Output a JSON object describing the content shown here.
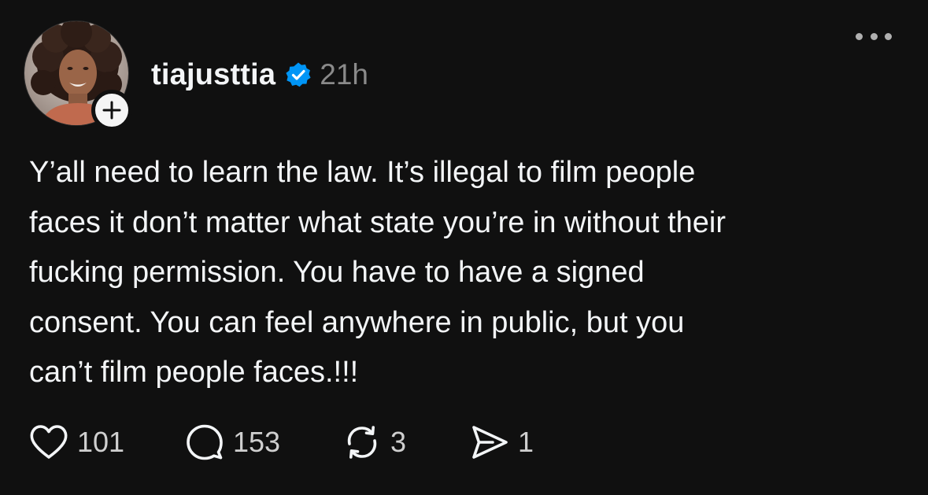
{
  "post": {
    "author": {
      "username": "tiajusttia",
      "verified": true,
      "avatar_icon": "profile-photo",
      "follow_icon": "plus-icon"
    },
    "timestamp": "21h",
    "menu_icon": "more-horizontal-icon",
    "text_lines": [
      "Y’all need to learn the law. It’s illegal to film people",
      "faces it don’t matter what state you’re in without their",
      "fucking permission. You have to have a signed",
      "consent. You can feel anywhere in public, but you",
      "can’t film people faces.!!!"
    ],
    "actions": {
      "like": {
        "icon": "heart-icon",
        "count": "101"
      },
      "reply": {
        "icon": "comment-icon",
        "count": "153"
      },
      "repost": {
        "icon": "repost-icon",
        "count": "3"
      },
      "share": {
        "icon": "send-icon",
        "count": "1"
      }
    }
  },
  "colors": {
    "background": "#101010",
    "text": "#f3f5f7",
    "muted": "#8a8a8a",
    "verified_blue": "#0095f6"
  }
}
